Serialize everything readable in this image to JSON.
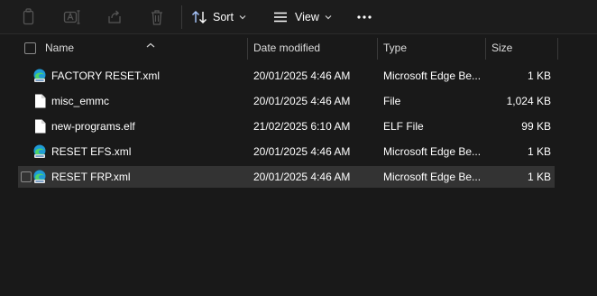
{
  "toolbar": {
    "sort_label": "Sort",
    "view_label": "View"
  },
  "columns": {
    "name": "Name",
    "date": "Date modified",
    "type": "Type",
    "size": "Size"
  },
  "files": [
    {
      "name": "FACTORY RESET.xml",
      "date": "20/01/2025 4:46 AM",
      "type": "Microsoft Edge Be...",
      "size": "1 KB",
      "icon": "edge-beta-icon"
    },
    {
      "name": "misc_emmc",
      "date": "20/01/2025 4:46 AM",
      "type": "File",
      "size": "1,024 KB",
      "icon": "file-icon"
    },
    {
      "name": "new-programs.elf",
      "date": "21/02/2025 6:10 AM",
      "type": "ELF File",
      "size": "99 KB",
      "icon": "file-icon"
    },
    {
      "name": "RESET EFS.xml",
      "date": "20/01/2025 4:46 AM",
      "type": "Microsoft Edge Be...",
      "size": "1 KB",
      "icon": "edge-beta-icon"
    },
    {
      "name": "RESET FRP.xml",
      "date": "20/01/2025 4:46 AM",
      "type": "Microsoft Edge Be...",
      "size": "1 KB",
      "icon": "edge-beta-icon",
      "selected": true
    }
  ],
  "colors": {
    "background": "#191919",
    "selected_row": "#333333",
    "text": "#ffffff",
    "header_text": "#dcdcdc"
  }
}
